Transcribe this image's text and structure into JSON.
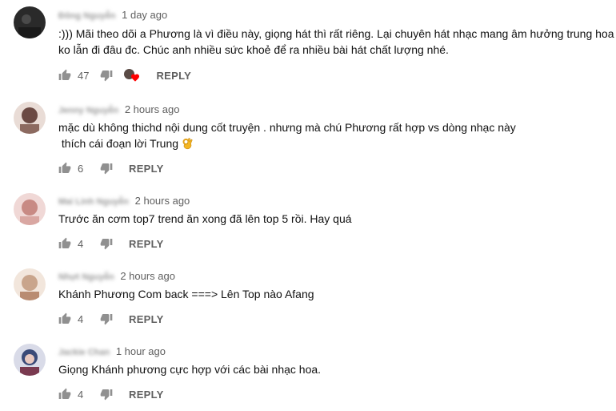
{
  "comments": [
    {
      "author": "Đông Nguyễn",
      "time": "1 day ago",
      "lines": [
        ":))) Mãi theo dõi a Phương là vì điều này, giọng hát thì rất riêng. Lại chuyên hát nhạc mang âm hưởng trung hoa",
        "ko lẫn đi đâu đc. Chúc anh nhiều sức khoẻ để ra nhiều bài hát chất lượng nhé."
      ],
      "likes": "47",
      "reply_label": "REPLY",
      "creator_heart": true,
      "avatar_color": "#2a2a2a"
    },
    {
      "author": "Jenny Nguyễn",
      "time": "2 hours ago",
      "lines": [
        "mặc dù không thichd nội dung cốt truyện . nhưng mà chú Phương rất hợp vs dòng nhạc này",
        " thích cái đoạn lời Trung"
      ],
      "likes": "6",
      "reply_label": "REPLY",
      "creator_heart": false,
      "avatar_color": "#6b4a44"
    },
    {
      "author": "Mai Linh Nguyễn",
      "time": "2 hours ago",
      "lines": [
        "Trước ăn cơm top7 trend ăn xong đã lên top 5 rồi. Hay quá"
      ],
      "likes": "4",
      "reply_label": "REPLY",
      "creator_heart": false,
      "avatar_color": "#c88a84"
    },
    {
      "author": "Nhựt Nguyễn",
      "time": "2 hours ago",
      "lines": [
        "Khánh Phương Com back ===> Lên Top nào Afang"
      ],
      "likes": "4",
      "reply_label": "REPLY",
      "creator_heart": false,
      "avatar_color": "#c9a58c"
    },
    {
      "author": "Jackie Chan",
      "time": "1 hour ago",
      "lines": [
        "Giọng Khánh phương cực hợp với các bài nhạc hoa."
      ],
      "likes": "4",
      "reply_label": "REPLY",
      "creator_heart": false,
      "avatar_color": "#3a4a78"
    }
  ],
  "colors": {
    "icon": "#909090",
    "meta_text": "#606060",
    "body_text": "#111111",
    "heart": "#ff0000"
  },
  "icons": {
    "like": "thumbs-up-icon",
    "dislike": "thumbs-down-icon",
    "creator_heart": "heart-icon",
    "emoji": "ok-hand-emoji-icon"
  }
}
